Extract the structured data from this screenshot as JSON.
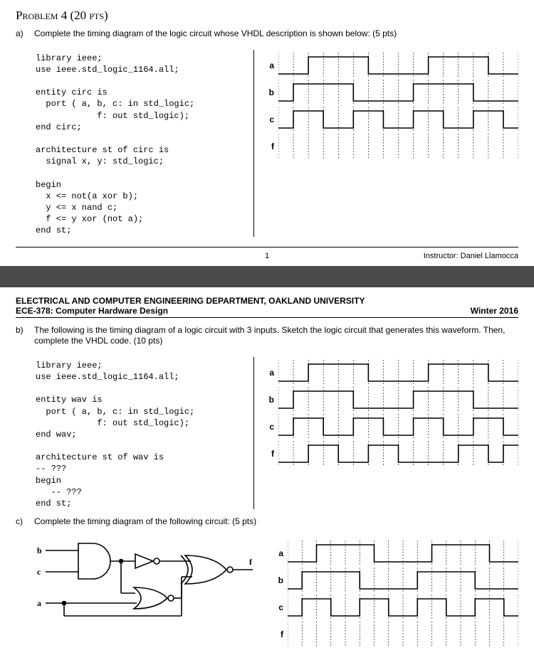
{
  "problem": {
    "title": "Problem 4 (20 pts)",
    "part_a_label": "a)",
    "part_a_text": "Complete the timing diagram of the logic circuit whose VHDL description is shown below: (5 pts)",
    "part_b_label": "b)",
    "part_b_text": "The following is the timing diagram of a logic circuit with 3 inputs. Sketch the logic circuit that generates this waveform. Then, complete the VHDL code. (10 pts)",
    "part_c_label": "c)",
    "part_c_text": "Complete the timing diagram of the following circuit: (5 pts)"
  },
  "footer": {
    "page": "1",
    "instructor": "Instructor: Daniel Llamocca"
  },
  "header2": {
    "dept": "ELECTRICAL AND COMPUTER ENGINEERING DEPARTMENT, OAKLAND UNIVERSITY",
    "course": "ECE-378: Computer Hardware Design",
    "term": "Winter 2016"
  },
  "code_a": "library ieee;\nuse ieee.std_logic_1164.all;\n\nentity circ is\n  port ( a, b, c: in std_logic;\n            f: out std_logic);\nend circ;\n\narchitecture st of circ is\n  signal x, y: std_logic;\n\nbegin\n  x <= not(a xor b);\n  y <= x nand c;\n  f <= y xor (not a);\nend st;",
  "code_b": "library ieee;\nuse ieee.std_logic_1164.all;\n\nentity wav is\n  port ( a, b, c: in std_logic;\n            f: out std_logic);\nend wav;\n\narchitecture st of wav is\n-- ???\nbegin\n   -- ???\nend st;",
  "signals_a": {
    "a": {
      "label": "a",
      "bits": "0011110000111100"
    },
    "b": {
      "label": "b",
      "bits": "0111100001111000"
    },
    "c": {
      "label": "c",
      "bits": "0110011001100110"
    },
    "f": {
      "label": "f",
      "bits": ""
    }
  },
  "signals_b": {
    "a": {
      "label": "a",
      "bits": "0011110000111100"
    },
    "b": {
      "label": "b",
      "bits": "0111100001111000"
    },
    "c": {
      "label": "c",
      "bits": "0110011001100110"
    },
    "f": {
      "label": "f",
      "bits": "0011001100001101"
    }
  },
  "signals_c": {
    "a": {
      "label": "a",
      "bits": "0011110000111100"
    },
    "b": {
      "label": "b",
      "bits": "0111100001111000"
    },
    "c": {
      "label": "c",
      "bits": "0110011001100110"
    },
    "f": {
      "label": "f",
      "bits": ""
    }
  },
  "circuit": {
    "inputs": [
      "b",
      "c",
      "a"
    ],
    "output": "f"
  }
}
